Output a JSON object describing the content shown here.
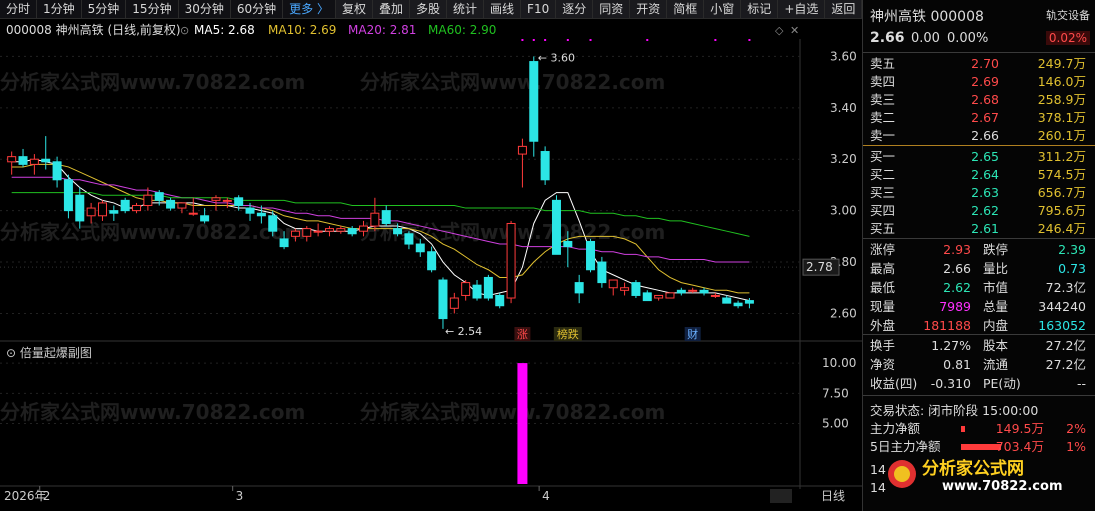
{
  "toolbar": {
    "items": [
      "分时",
      "1分钟",
      "5分钟",
      "15分钟",
      "30分钟",
      "60分钟",
      "更多 〉"
    ],
    "buttons": [
      "复权",
      "叠加",
      "多股",
      "统计",
      "画线",
      "F10",
      "逐分",
      "同资",
      "开资",
      "简框",
      "小窗",
      "标记",
      "+自选",
      "返回"
    ]
  },
  "chart_header": {
    "stock": "000008 神州高铁 (日线,前复权)",
    "ma5": "MA5: 2.68",
    "ma10": "MA10: 2.69",
    "ma20": "MA20: 2.81",
    "ma60": "MA60: 2.90"
  },
  "colors": {
    "up": "#ff3b3b",
    "down": "#2ce6e6",
    "ma5": "#ffffff",
    "ma10": "#e0c030",
    "ma20": "#d040e0",
    "ma60": "#20c020",
    "volume": "#ff00ff",
    "marker": "#ff00ff"
  },
  "watermark": "分析家公式网www.70822.com",
  "chart_data": {
    "type": "candlestick",
    "price_ticks": [
      3.6,
      3.4,
      3.2,
      3.0,
      2.8,
      2.6
    ],
    "ylim": [
      2.52,
      3.66
    ],
    "last_price_label": "2.78",
    "annotations": {
      "high": "3.60",
      "low": "2.54"
    },
    "event_tags": [
      "涨",
      "榜跌",
      "财"
    ],
    "candles": [
      {
        "o": 3.19,
        "h": 3.23,
        "l": 3.14,
        "c": 3.21
      },
      {
        "o": 3.21,
        "h": 3.24,
        "l": 3.17,
        "c": 3.18
      },
      {
        "o": 3.18,
        "h": 3.22,
        "l": 3.14,
        "c": 3.2
      },
      {
        "o": 3.2,
        "h": 3.29,
        "l": 3.16,
        "c": 3.19
      },
      {
        "o": 3.19,
        "h": 3.21,
        "l": 3.09,
        "c": 3.12
      },
      {
        "o": 3.12,
        "h": 3.14,
        "l": 2.97,
        "c": 3.0
      },
      {
        "o": 3.06,
        "h": 3.09,
        "l": 2.93,
        "c": 2.96
      },
      {
        "o": 2.98,
        "h": 3.03,
        "l": 2.95,
        "c": 3.01
      },
      {
        "o": 2.98,
        "h": 3.04,
        "l": 2.96,
        "c": 3.03
      },
      {
        "o": 3.0,
        "h": 3.02,
        "l": 2.96,
        "c": 2.99
      },
      {
        "o": 3.04,
        "h": 3.05,
        "l": 2.99,
        "c": 3.0
      },
      {
        "o": 3.0,
        "h": 3.03,
        "l": 2.99,
        "c": 3.02
      },
      {
        "o": 3.02,
        "h": 3.09,
        "l": 3.0,
        "c": 3.06
      },
      {
        "o": 3.07,
        "h": 3.08,
        "l": 3.02,
        "c": 3.04
      },
      {
        "o": 3.04,
        "h": 3.05,
        "l": 3.0,
        "c": 3.01
      },
      {
        "o": 3.01,
        "h": 3.03,
        "l": 2.99,
        "c": 3.03
      },
      {
        "o": 2.99,
        "h": 3.05,
        "l": 2.98,
        "c": 2.99
      },
      {
        "o": 2.98,
        "h": 3.01,
        "l": 2.95,
        "c": 2.96
      },
      {
        "o": 3.04,
        "h": 3.06,
        "l": 3.0,
        "c": 3.05
      },
      {
        "o": 3.04,
        "h": 3.05,
        "l": 3.01,
        "c": 3.04
      },
      {
        "o": 3.05,
        "h": 3.06,
        "l": 3.0,
        "c": 3.02
      },
      {
        "o": 3.01,
        "h": 3.03,
        "l": 2.96,
        "c": 2.99
      },
      {
        "o": 2.99,
        "h": 3.02,
        "l": 2.95,
        "c": 2.98
      },
      {
        "o": 2.98,
        "h": 3.0,
        "l": 2.9,
        "c": 2.92
      },
      {
        "o": 2.89,
        "h": 2.92,
        "l": 2.85,
        "c": 2.86
      },
      {
        "o": 2.9,
        "h": 2.93,
        "l": 2.88,
        "c": 2.92
      },
      {
        "o": 2.9,
        "h": 2.94,
        "l": 2.88,
        "c": 2.93
      },
      {
        "o": 2.92,
        "h": 2.95,
        "l": 2.9,
        "c": 2.92
      },
      {
        "o": 2.92,
        "h": 2.94,
        "l": 2.9,
        "c": 2.93
      },
      {
        "o": 2.92,
        "h": 2.94,
        "l": 2.91,
        "c": 2.93
      },
      {
        "o": 2.93,
        "h": 2.94,
        "l": 2.9,
        "c": 2.91
      },
      {
        "o": 2.92,
        "h": 2.96,
        "l": 2.9,
        "c": 2.94
      },
      {
        "o": 2.94,
        "h": 3.05,
        "l": 2.92,
        "c": 2.99
      },
      {
        "o": 3.0,
        "h": 3.02,
        "l": 2.94,
        "c": 2.95
      },
      {
        "o": 2.93,
        "h": 2.95,
        "l": 2.9,
        "c": 2.91
      },
      {
        "o": 2.91,
        "h": 2.92,
        "l": 2.85,
        "c": 2.87
      },
      {
        "o": 2.87,
        "h": 2.89,
        "l": 2.82,
        "c": 2.84
      },
      {
        "o": 2.84,
        "h": 2.86,
        "l": 2.76,
        "c": 2.77
      },
      {
        "o": 2.73,
        "h": 2.74,
        "l": 2.54,
        "c": 2.58
      },
      {
        "o": 2.62,
        "h": 2.68,
        "l": 2.6,
        "c": 2.66
      },
      {
        "o": 2.67,
        "h": 2.73,
        "l": 2.65,
        "c": 2.72
      },
      {
        "o": 2.71,
        "h": 2.73,
        "l": 2.65,
        "c": 2.66
      },
      {
        "o": 2.74,
        "h": 2.75,
        "l": 2.65,
        "c": 2.66
      },
      {
        "o": 2.67,
        "h": 2.68,
        "l": 2.62,
        "c": 2.63
      },
      {
        "o": 2.66,
        "h": 2.96,
        "l": 2.64,
        "c": 2.95
      },
      {
        "o": 3.22,
        "h": 3.28,
        "l": 3.09,
        "c": 3.25
      },
      {
        "o": 3.58,
        "h": 3.6,
        "l": 3.21,
        "c": 3.27
      },
      {
        "o": 3.23,
        "h": 3.25,
        "l": 3.1,
        "c": 3.12
      },
      {
        "o": 3.04,
        "h": 3.06,
        "l": 2.83,
        "c": 2.83
      },
      {
        "o": 2.88,
        "h": 2.92,
        "l": 2.78,
        "c": 2.86
      },
      {
        "o": 2.72,
        "h": 2.75,
        "l": 2.64,
        "c": 2.68
      },
      {
        "o": 2.88,
        "h": 2.89,
        "l": 2.76,
        "c": 2.77
      },
      {
        "o": 2.8,
        "h": 2.82,
        "l": 2.7,
        "c": 2.72
      },
      {
        "o": 2.7,
        "h": 2.73,
        "l": 2.67,
        "c": 2.73
      },
      {
        "o": 2.69,
        "h": 2.72,
        "l": 2.67,
        "c": 2.7
      },
      {
        "o": 2.72,
        "h": 2.73,
        "l": 2.66,
        "c": 2.67
      },
      {
        "o": 2.68,
        "h": 2.69,
        "l": 2.65,
        "c": 2.65
      },
      {
        "o": 2.66,
        "h": 2.67,
        "l": 2.65,
        "c": 2.67
      },
      {
        "o": 2.66,
        "h": 2.68,
        "l": 2.66,
        "c": 2.68
      },
      {
        "o": 2.69,
        "h": 2.7,
        "l": 2.67,
        "c": 2.68
      },
      {
        "o": 2.69,
        "h": 2.7,
        "l": 2.68,
        "c": 2.69
      },
      {
        "o": 2.69,
        "h": 2.7,
        "l": 2.67,
        "c": 2.68
      },
      {
        "o": 2.67,
        "h": 2.68,
        "l": 2.66,
        "c": 2.67
      },
      {
        "o": 2.66,
        "h": 2.67,
        "l": 2.64,
        "c": 2.64
      },
      {
        "o": 2.64,
        "h": 2.65,
        "l": 2.62,
        "c": 2.63
      },
      {
        "o": 2.65,
        "h": 2.66,
        "l": 2.62,
        "c": 2.64
      }
    ],
    "ma_series": [
      {
        "name": "MA5",
        "values": [
          3.19,
          3.19,
          3.2,
          3.19,
          3.18,
          3.13,
          3.09,
          3.06,
          3.04,
          3.03,
          3.01,
          3.01,
          3.03,
          3.03,
          3.03,
          3.03,
          3.03,
          3.02,
          3.02,
          3.02,
          3.01,
          3.01,
          3.0,
          2.99,
          2.95,
          2.93,
          2.93,
          2.92,
          2.92,
          2.92,
          2.92,
          2.93,
          2.94,
          2.94,
          2.94,
          2.93,
          2.91,
          2.87,
          2.8,
          2.75,
          2.72,
          2.68,
          2.67,
          2.68,
          2.69,
          2.78,
          2.95,
          3.04,
          3.07,
          3.07,
          2.96,
          2.84,
          2.77,
          2.75,
          2.73,
          2.71,
          2.7,
          2.69,
          2.68,
          2.68,
          2.68,
          2.68,
          2.68,
          2.67,
          2.66,
          2.65
        ]
      },
      {
        "name": "MA10",
        "values": [
          3.17,
          3.17,
          3.18,
          3.18,
          3.18,
          3.17,
          3.15,
          3.13,
          3.11,
          3.09,
          3.07,
          3.05,
          3.04,
          3.04,
          3.03,
          3.03,
          3.02,
          3.02,
          3.02,
          3.02,
          3.02,
          3.02,
          3.01,
          3.0,
          2.98,
          2.97,
          2.96,
          2.96,
          2.95,
          2.94,
          2.93,
          2.93,
          2.93,
          2.93,
          2.93,
          2.93,
          2.92,
          2.9,
          2.87,
          2.85,
          2.82,
          2.79,
          2.77,
          2.74,
          2.74,
          2.75,
          2.8,
          2.84,
          2.87,
          2.89,
          2.9,
          2.9,
          2.9,
          2.9,
          2.89,
          2.87,
          2.82,
          2.77,
          2.74,
          2.72,
          2.71,
          2.7,
          2.69,
          2.69,
          2.68,
          2.68
        ]
      },
      {
        "name": "MA20",
        "values": [
          3.13,
          3.13,
          3.13,
          3.13,
          3.13,
          3.12,
          3.12,
          3.11,
          3.1,
          3.1,
          3.09,
          3.08,
          3.08,
          3.07,
          3.06,
          3.05,
          3.05,
          3.04,
          3.03,
          3.03,
          3.02,
          3.02,
          3.01,
          3.01,
          3.0,
          2.99,
          2.99,
          2.98,
          2.98,
          2.97,
          2.97,
          2.97,
          2.97,
          2.96,
          2.96,
          2.95,
          2.94,
          2.93,
          2.92,
          2.91,
          2.9,
          2.89,
          2.88,
          2.87,
          2.87,
          2.86,
          2.86,
          2.86,
          2.86,
          2.86,
          2.85,
          2.85,
          2.84,
          2.84,
          2.83,
          2.83,
          2.82,
          2.82,
          2.81,
          2.81,
          2.81,
          2.81,
          2.8,
          2.8,
          2.8,
          2.8
        ]
      },
      {
        "name": "MA60",
        "values": [
          3.07,
          3.07,
          3.07,
          3.07,
          3.07,
          3.07,
          3.07,
          3.07,
          3.06,
          3.06,
          3.06,
          3.06,
          3.06,
          3.06,
          3.05,
          3.05,
          3.05,
          3.05,
          3.05,
          3.05,
          3.04,
          3.04,
          3.04,
          3.04,
          3.04,
          3.03,
          3.03,
          3.03,
          3.03,
          3.03,
          3.02,
          3.02,
          3.02,
          3.02,
          3.02,
          3.02,
          3.02,
          3.02,
          3.02,
          3.02,
          3.01,
          3.01,
          3.01,
          3.01,
          3.01,
          3.01,
          3.01,
          3.0,
          3.0,
          3.0,
          3.0,
          2.99,
          2.99,
          2.99,
          2.98,
          2.98,
          2.97,
          2.97,
          2.96,
          2.96,
          2.95,
          2.94,
          2.93,
          2.92,
          2.91,
          2.9
        ]
      }
    ],
    "top_markers": [
      45,
      46,
      47,
      49,
      51,
      56,
      62,
      65
    ],
    "subchart": {
      "title": "倍量起爆副图",
      "ticks": [
        10.0,
        7.5,
        5.0
      ],
      "ylim": [
        0,
        11
      ],
      "bars": [
        {
          "index": 45,
          "value": 10.0
        }
      ]
    },
    "x_labels": [
      {
        "label": "2026年",
        "index": 0
      },
      {
        "label": "2",
        "index": 3
      },
      {
        "label": "3",
        "index": 20
      },
      {
        "label": "4",
        "index": 47
      }
    ],
    "x_right_label": "日线"
  },
  "quote": {
    "name": "神州高铁 000008",
    "tag": "轨交设备",
    "price": "2.66",
    "change": "0.00",
    "change_pct": "0.00%",
    "weibi": "0.02%",
    "asks": [
      {
        "label": "卖五",
        "price": "2.70",
        "vol": "249.7万"
      },
      {
        "label": "卖四",
        "price": "2.69",
        "vol": "146.0万"
      },
      {
        "label": "卖三",
        "price": "2.68",
        "vol": "258.9万"
      },
      {
        "label": "卖二",
        "price": "2.67",
        "vol": "378.1万"
      },
      {
        "label": "卖一",
        "price": "2.66",
        "vol": "260.1万"
      }
    ],
    "bids": [
      {
        "label": "买一",
        "price": "2.65",
        "vol": "311.2万"
      },
      {
        "label": "买二",
        "price": "2.64",
        "vol": "574.5万"
      },
      {
        "label": "买三",
        "price": "2.63",
        "vol": "656.7万"
      },
      {
        "label": "买四",
        "price": "2.62",
        "vol": "795.6万"
      },
      {
        "label": "买五",
        "price": "2.61",
        "vol": "246.4万"
      }
    ],
    "stats": [
      {
        "k1": "涨停",
        "v1": "2.93",
        "c1": "r",
        "k2": "跌停",
        "v2": "2.39",
        "c2": "g"
      },
      {
        "k1": "最高",
        "v1": "2.66",
        "c1": "w",
        "k2": "量比",
        "v2": "0.73",
        "c2": "cy"
      },
      {
        "k1": "最低",
        "v1": "2.62",
        "c1": "g",
        "k2": "市值",
        "v2": "72.3亿",
        "c2": "w"
      },
      {
        "k1": "现量",
        "v1": "7989",
        "c1": "m",
        "k2": "总量",
        "v2": "344240",
        "c2": "w"
      },
      {
        "k1": "外盘",
        "v1": "181188",
        "c1": "r",
        "k2": "内盘",
        "v2": "163052",
        "c2": "cy"
      }
    ],
    "finance": [
      {
        "k1": "换手",
        "v1": "1.27%",
        "k2": "股本",
        "v2": "27.2亿"
      },
      {
        "k1": "净资",
        "v1": "0.81",
        "k2": "流通",
        "v2": "27.2亿"
      },
      {
        "k1": "收益(四)",
        "v1": "-0.310",
        "k2": "PE(动)",
        "v2": "--"
      }
    ],
    "status": "交易状态: 闭市阶段 15:00:00",
    "flow": [
      {
        "label": "主力净额",
        "value": "149.5万",
        "pct": "2%"
      },
      {
        "label": "5日主力净额",
        "value": "703.4万",
        "pct": "1%"
      }
    ],
    "tail": [
      "14",
      "14"
    ],
    "logo_text": "分析家公式网",
    "logo_url": "www.70822.com"
  }
}
